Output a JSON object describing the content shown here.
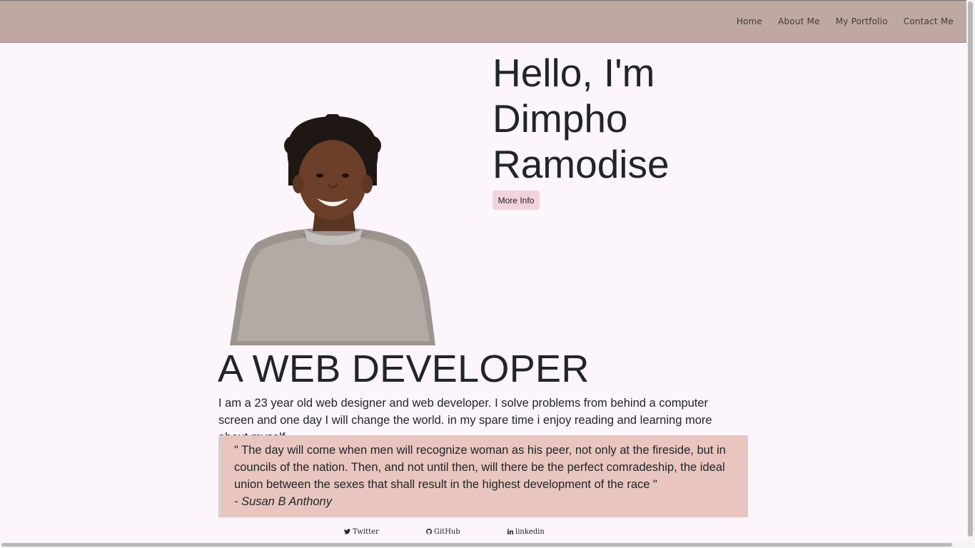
{
  "nav": {
    "items": [
      {
        "label": "Home"
      },
      {
        "label": "About Me"
      },
      {
        "label": "My Portfolio"
      },
      {
        "label": "Contact Me"
      }
    ]
  },
  "hero": {
    "greeting": "Hello, I'm",
    "first_name": "Dimpho",
    "last_name": "Ramodise",
    "button_label": "More Info"
  },
  "about": {
    "title": "A WEB DEVELOPER",
    "bio": "I am a 23 year old web designer and web developer. I solve problems from behind a computer screen and one day I will change the world. in my spare time i enjoy reading and learning more about myself"
  },
  "quote": {
    "text": "\" The day will come when men will recognize woman as his peer, not only at the fireside, but in councils of the nation. Then, and not until then, will there be the perfect comradeship, the ideal union between the sexes that shall result in the highest development of the race \"",
    "author": "- Susan B Anthony"
  },
  "social": {
    "twitter": {
      "label": "Twitter",
      "icon": "twitter-icon"
    },
    "github": {
      "label": "GitHub",
      "icon": "github-icon"
    },
    "linkedin": {
      "label": "linkedin",
      "icon": "linkedin-icon"
    }
  },
  "colors": {
    "navbar": "#bfa8a1",
    "page_background": "#fdf5fc",
    "button": "#f3d3da",
    "quote_background": "#e8c6bf"
  }
}
